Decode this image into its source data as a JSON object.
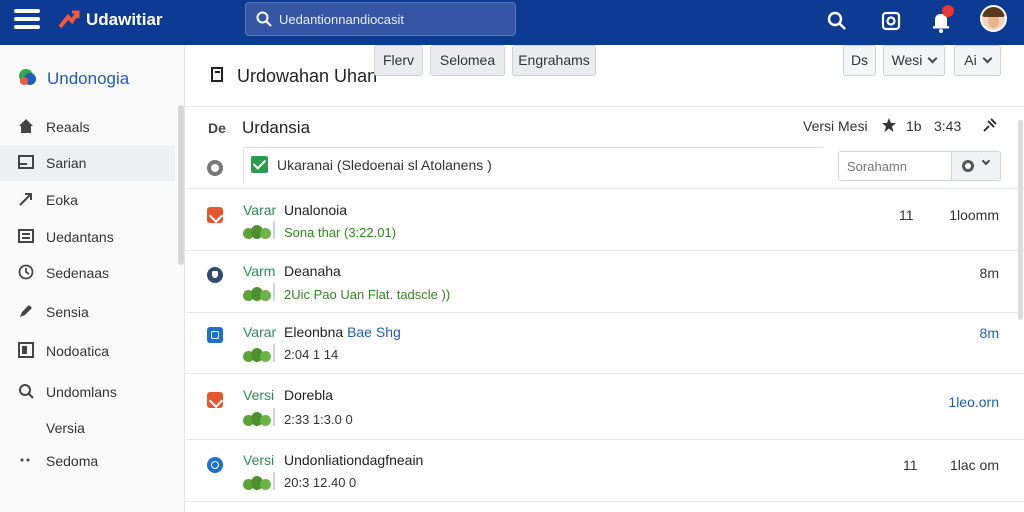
{
  "topbar": {
    "app_title": "Udawitiar",
    "search_text": "Uedantionnandiocasit",
    "bg_color": "#0d3a93"
  },
  "sidebar": {
    "brand": "Undonogia",
    "items": [
      {
        "label": "Reaals",
        "icon": "home-icon"
      },
      {
        "label": "Sarian",
        "icon": "doc-icon",
        "active": true
      },
      {
        "label": "Eoka",
        "icon": "arrow-icon"
      },
      {
        "label": "Uedantans",
        "icon": "inbox-icon"
      },
      {
        "label": "Sedenaas",
        "icon": "clock-icon"
      },
      {
        "label": "Sensia",
        "icon": "pen-icon"
      },
      {
        "label": "Nodoatica",
        "icon": "square-icon"
      },
      {
        "label": "Undomlans",
        "icon": "search-icon"
      },
      {
        "label": "Versia",
        "icon": ""
      },
      {
        "label": "Sedoma",
        "icon": "dots-icon"
      }
    ]
  },
  "header": {
    "title": "Urdowahan Uhan",
    "btn1": "Flerv",
    "btn2": "Selomea",
    "btn3": "Engrahams",
    "right1": "Ds",
    "right2": "Wesi",
    "right3": "Ai"
  },
  "content": {
    "doc_label": "De",
    "title": "Urdansia",
    "version": "Versi Mesi",
    "count": "1b",
    "time": "3:43",
    "filter_text": "Ukaranai (Sledoenai sl Atolanens )",
    "search_placeholder": "Sorahamn",
    "rows": [
      {
        "tag": "Varar",
        "name": "Unalonoia",
        "name_accent": "",
        "sub": "Sona thar (3:22.01)",
        "sub_style": "green",
        "num": "11",
        "right": "1loomm",
        "right_style": "gray",
        "icon": "orange"
      },
      {
        "tag": "Varm",
        "name": "Deanaha",
        "name_accent": "",
        "sub": "2Uic Pao Uan Flat. tadscle ))",
        "sub_style": "green",
        "num": "",
        "right": "8m",
        "right_style": "gray",
        "icon": "navy"
      },
      {
        "tag": "Varar",
        "name": "Eleonbna ",
        "name_accent": "Bae Shg",
        "sub": "2:04 1 14",
        "sub_style": "gray",
        "num": "",
        "right": "8m",
        "right_style": "blue",
        "icon": "blue"
      },
      {
        "tag": "Versi",
        "name": "Dorebla",
        "name_accent": "",
        "sub": "2:33 1:3.0 0",
        "sub_style": "gray",
        "num": "",
        "right": "1leo.orn",
        "right_style": "blue",
        "icon": "orange"
      },
      {
        "tag": "Versi",
        "name": "Undonliationdagfneain",
        "name_accent": "",
        "sub": "20:3 12.40 0",
        "sub_style": "gray",
        "num": "11",
        "right": "1lac om",
        "right_style": "gray",
        "icon": "blue2"
      }
    ]
  }
}
